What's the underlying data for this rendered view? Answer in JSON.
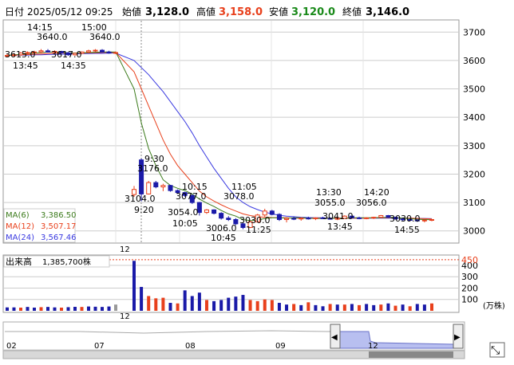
{
  "header": {
    "date_label": "日付",
    "date_value": "2025/05/12 09:25",
    "open_label": "始値",
    "open_value": "3,128.0",
    "high_label": "高値",
    "high_value": "3,158.0",
    "low_label": "安値",
    "low_value": "3,120.0",
    "close_label": "終値",
    "close_value": "3,146.0"
  },
  "colors": {
    "up": "#e8401c",
    "down": "#1a1aa8",
    "high_text": "#e8401c",
    "low_text": "#1a8a1a",
    "ma6": "#3a7a1a",
    "ma12": "#e8401c",
    "ma24": "#3a3ae0",
    "cursor": "#888888",
    "grid": "#cccccc",
    "volume_gray": "#999999",
    "navigator_fill": "#b8bff0"
  },
  "legend": [
    {
      "name": "MA(6)",
      "value": "3,386.50"
    },
    {
      "name": "MA(12)",
      "value": "3,507.17"
    },
    {
      "name": "MA(24)",
      "value": "3,567.46"
    }
  ],
  "volume_panel": {
    "label": "出来高",
    "value": "1,385,700株",
    "unit": "(万株)"
  },
  "annotations": [
    {
      "time": "14:15",
      "price": "3640.0"
    },
    {
      "time": "15:00",
      "price": "3640.0"
    },
    {
      "time": "13:45",
      "price": "3615.0"
    },
    {
      "time": "14:35",
      "price": "3617.0"
    },
    {
      "time": "9:30",
      "price": "3176.0"
    },
    {
      "time": "9:20",
      "price": "3104.0"
    },
    {
      "time": "10:15",
      "price": "3077.0"
    },
    {
      "time": "10:05",
      "price": "3054.0"
    },
    {
      "time": "11:05",
      "price": "3078.0"
    },
    {
      "time": "10:45",
      "price": "3006.0"
    },
    {
      "time": "11:25",
      "price": "3030.0"
    },
    {
      "time": "13:30",
      "price": "3055.0"
    },
    {
      "time": "13:45",
      "price": "3041.0"
    },
    {
      "time": "14:20",
      "price": "3056.0"
    },
    {
      "time": "14:55",
      "price": "3030.0"
    }
  ],
  "cursor_label": "12",
  "volume_cursor_label": "12",
  "navigator": {
    "labels": [
      "02",
      "07",
      "08",
      "09",
      "12"
    ],
    "left_arrow": "◀",
    "right_arrow": "▶",
    "expand_icon": "⤡"
  },
  "chart_data": {
    "type": "candlestick",
    "price_axis": {
      "ticks": [
        3000,
        3100,
        3200,
        3300,
        3400,
        3500,
        3600,
        3700
      ],
      "ylim": [
        2960,
        3740
      ]
    },
    "volume_axis": {
      "ticks": [
        100,
        200,
        300,
        400,
        450
      ],
      "ylim": [
        0,
        470
      ],
      "unit": "万株"
    },
    "candles": [
      {
        "o": 3615,
        "h": 3622,
        "l": 3612,
        "c": 3618
      },
      {
        "o": 3618,
        "h": 3624,
        "l": 3614,
        "c": 3620
      },
      {
        "o": 3620,
        "h": 3630,
        "l": 3616,
        "c": 3626
      },
      {
        "o": 3626,
        "h": 3632,
        "l": 3620,
        "c": 3628
      },
      {
        "o": 3628,
        "h": 3634,
        "l": 3622,
        "c": 3630
      },
      {
        "o": 3630,
        "h": 3640,
        "l": 3626,
        "c": 3634
      },
      {
        "o": 3634,
        "h": 3640,
        "l": 3628,
        "c": 3630
      },
      {
        "o": 3630,
        "h": 3636,
        "l": 3625,
        "c": 3632
      },
      {
        "o": 3632,
        "h": 3634,
        "l": 3624,
        "c": 3627
      },
      {
        "o": 3627,
        "h": 3630,
        "l": 3617,
        "c": 3620
      },
      {
        "o": 3620,
        "h": 3628,
        "l": 3617,
        "c": 3625
      },
      {
        "o": 3625,
        "h": 3632,
        "l": 3622,
        "c": 3630
      },
      {
        "o": 3630,
        "h": 3638,
        "l": 3626,
        "c": 3634
      },
      {
        "o": 3634,
        "h": 3640,
        "l": 3630,
        "c": 3636
      },
      {
        "o": 3636,
        "h": 3640,
        "l": 3628,
        "c": 3630
      },
      {
        "o": 3630,
        "h": 3634,
        "l": 3624,
        "c": 3626
      },
      {
        "o": 3626,
        "h": 3632,
        "l": 3622,
        "c": 3628
      },
      {
        "o": 3128,
        "h": 3158,
        "l": 3120,
        "c": 3146
      },
      {
        "o": 3250,
        "h": 3255,
        "l": 3104,
        "c": 3130
      },
      {
        "o": 3130,
        "h": 3176,
        "l": 3128,
        "c": 3170
      },
      {
        "o": 3170,
        "h": 3176,
        "l": 3150,
        "c": 3155
      },
      {
        "o": 3155,
        "h": 3166,
        "l": 3140,
        "c": 3160
      },
      {
        "o": 3160,
        "h": 3162,
        "l": 3138,
        "c": 3142
      },
      {
        "o": 3142,
        "h": 3146,
        "l": 3130,
        "c": 3135
      },
      {
        "o": 3135,
        "h": 3138,
        "l": 3120,
        "c": 3125
      },
      {
        "o": 3125,
        "h": 3128,
        "l": 3095,
        "c": 3100
      },
      {
        "o": 3100,
        "h": 3102,
        "l": 3054,
        "c": 3065
      },
      {
        "o": 3065,
        "h": 3077,
        "l": 3060,
        "c": 3074
      },
      {
        "o": 3074,
        "h": 3076,
        "l": 3058,
        "c": 3062
      },
      {
        "o": 3062,
        "h": 3066,
        "l": 3040,
        "c": 3045
      },
      {
        "o": 3045,
        "h": 3052,
        "l": 3035,
        "c": 3040
      },
      {
        "o": 3040,
        "h": 3045,
        "l": 3020,
        "c": 3025
      },
      {
        "o": 3025,
        "h": 3030,
        "l": 3006,
        "c": 3012
      },
      {
        "o": 3012,
        "h": 3036,
        "l": 3010,
        "c": 3032
      },
      {
        "o": 3032,
        "h": 3060,
        "l": 3030,
        "c": 3056
      },
      {
        "o": 3056,
        "h": 3078,
        "l": 3050,
        "c": 3070
      },
      {
        "o": 3070,
        "h": 3074,
        "l": 3055,
        "c": 3058
      },
      {
        "o": 3058,
        "h": 3062,
        "l": 3035,
        "c": 3040
      },
      {
        "o": 3040,
        "h": 3048,
        "l": 3030,
        "c": 3044
      },
      {
        "o": 3044,
        "h": 3050,
        "l": 3038,
        "c": 3042
      },
      {
        "o": 3042,
        "h": 3048,
        "l": 3036,
        "c": 3045
      },
      {
        "o": 3045,
        "h": 3050,
        "l": 3040,
        "c": 3043
      },
      {
        "o": 3043,
        "h": 3048,
        "l": 3038,
        "c": 3046
      },
      {
        "o": 3046,
        "h": 3050,
        "l": 3042,
        "c": 3044
      },
      {
        "o": 3044,
        "h": 3048,
        "l": 3040,
        "c": 3042
      },
      {
        "o": 3042,
        "h": 3046,
        "l": 3038,
        "c": 3044
      },
      {
        "o": 3044,
        "h": 3055,
        "l": 3042,
        "c": 3052
      },
      {
        "o": 3052,
        "h": 3055,
        "l": 3044,
        "c": 3046
      },
      {
        "o": 3046,
        "h": 3050,
        "l": 3041,
        "c": 3044
      },
      {
        "o": 3044,
        "h": 3048,
        "l": 3041,
        "c": 3046
      },
      {
        "o": 3046,
        "h": 3050,
        "l": 3042,
        "c": 3048
      },
      {
        "o": 3048,
        "h": 3056,
        "l": 3046,
        "c": 3054
      },
      {
        "o": 3054,
        "h": 3056,
        "l": 3046,
        "c": 3048
      },
      {
        "o": 3048,
        "h": 3050,
        "l": 3040,
        "c": 3042
      },
      {
        "o": 3042,
        "h": 3046,
        "l": 3036,
        "c": 3040
      },
      {
        "o": 3040,
        "h": 3044,
        "l": 3034,
        "c": 3038
      },
      {
        "o": 3038,
        "h": 3042,
        "l": 3032,
        "c": 3036
      },
      {
        "o": 3036,
        "h": 3040,
        "l": 3030,
        "c": 3038
      },
      {
        "o": 3038,
        "h": 3042,
        "l": 3034,
        "c": 3040
      }
    ],
    "ma6": [
      3618,
      3620,
      3622,
      3624,
      3626,
      3628,
      3630,
      3630,
      3629,
      3627,
      3626,
      3627,
      3628,
      3629,
      3630,
      3630,
      3630,
      3500,
      3380,
      3290,
      3230,
      3180,
      3160,
      3150,
      3142,
      3130,
      3112,
      3098,
      3086,
      3072,
      3060,
      3052,
      3040,
      3036,
      3038,
      3044,
      3046,
      3046,
      3045,
      3046,
      3046,
      3045,
      3044,
      3044,
      3045,
      3044,
      3045,
      3046,
      3046,
      3046,
      3046,
      3047,
      3048,
      3047,
      3045,
      3043,
      3041,
      3040,
      3039
    ],
    "ma12": [
      3618,
      3619,
      3620,
      3621,
      3622,
      3623,
      3624,
      3625,
      3626,
      3626,
      3626,
      3626,
      3627,
      3627,
      3628,
      3628,
      3628,
      3560,
      3500,
      3440,
      3380,
      3320,
      3270,
      3230,
      3200,
      3170,
      3140,
      3120,
      3105,
      3092,
      3080,
      3070,
      3060,
      3054,
      3050,
      3048,
      3047,
      3046,
      3046,
      3045,
      3045,
      3045,
      3045,
      3045,
      3045,
      3045,
      3045,
      3045,
      3045,
      3045,
      3046,
      3046,
      3046,
      3046,
      3045,
      3045,
      3044,
      3043,
      3042
    ],
    "ma24": [
      3618,
      3618,
      3619,
      3619,
      3620,
      3620,
      3621,
      3622,
      3622,
      3623,
      3623,
      3624,
      3624,
      3625,
      3625,
      3626,
      3626,
      3600,
      3575,
      3550,
      3520,
      3490,
      3455,
      3420,
      3385,
      3345,
      3300,
      3260,
      3220,
      3185,
      3150,
      3120,
      3100,
      3085,
      3075,
      3066,
      3060,
      3055,
      3052,
      3050,
      3048,
      3047,
      3046,
      3046,
      3045,
      3045,
      3045,
      3045,
      3045,
      3045,
      3045,
      3045,
      3045,
      3045,
      3045,
      3045,
      3044,
      3044,
      3043
    ],
    "volume": [
      {
        "v": 30,
        "c": "down"
      },
      {
        "v": 30,
        "c": "down"
      },
      {
        "v": 28,
        "c": "up"
      },
      {
        "v": 34,
        "c": "down"
      },
      {
        "v": 28,
        "c": "down"
      },
      {
        "v": 32,
        "c": "up"
      },
      {
        "v": 34,
        "c": "down"
      },
      {
        "v": 30,
        "c": "down"
      },
      {
        "v": 28,
        "c": "up"
      },
      {
        "v": 32,
        "c": "down"
      },
      {
        "v": 35,
        "c": "down"
      },
      {
        "v": 34,
        "c": "up"
      },
      {
        "v": 38,
        "c": "down"
      },
      {
        "v": 36,
        "c": "down"
      },
      {
        "v": 34,
        "c": "down"
      },
      {
        "v": 38,
        "c": "down"
      },
      {
        "v": 55,
        "c": "gray"
      },
      {
        "v": 440,
        "c": "down"
      },
      {
        "v": 210,
        "c": "down"
      },
      {
        "v": 130,
        "c": "up"
      },
      {
        "v": 110,
        "c": "up"
      },
      {
        "v": 115,
        "c": "up"
      },
      {
        "v": 70,
        "c": "down"
      },
      {
        "v": 65,
        "c": "up"
      },
      {
        "v": 180,
        "c": "down"
      },
      {
        "v": 130,
        "c": "down"
      },
      {
        "v": 160,
        "c": "down"
      },
      {
        "v": 95,
        "c": "up"
      },
      {
        "v": 85,
        "c": "down"
      },
      {
        "v": 95,
        "c": "down"
      },
      {
        "v": 115,
        "c": "down"
      },
      {
        "v": 125,
        "c": "down"
      },
      {
        "v": 140,
        "c": "down"
      },
      {
        "v": 95,
        "c": "up"
      },
      {
        "v": 85,
        "c": "up"
      },
      {
        "v": 100,
        "c": "up"
      },
      {
        "v": 95,
        "c": "up"
      },
      {
        "v": 70,
        "c": "down"
      },
      {
        "v": 55,
        "c": "down"
      },
      {
        "v": 60,
        "c": "up"
      },
      {
        "v": 50,
        "c": "down"
      },
      {
        "v": 75,
        "c": "up"
      },
      {
        "v": 50,
        "c": "down"
      },
      {
        "v": 40,
        "c": "down"
      },
      {
        "v": 60,
        "c": "up"
      },
      {
        "v": 55,
        "c": "down"
      },
      {
        "v": 55,
        "c": "up"
      },
      {
        "v": 60,
        "c": "down"
      },
      {
        "v": 50,
        "c": "up"
      },
      {
        "v": 60,
        "c": "down"
      },
      {
        "v": 50,
        "c": "down"
      },
      {
        "v": 55,
        "c": "up"
      },
      {
        "v": 65,
        "c": "down"
      },
      {
        "v": 45,
        "c": "up"
      },
      {
        "v": 55,
        "c": "down"
      },
      {
        "v": 40,
        "c": "up"
      },
      {
        "v": 60,
        "c": "down"
      },
      {
        "v": 55,
        "c": "down"
      },
      {
        "v": 65,
        "c": "up"
      }
    ]
  }
}
